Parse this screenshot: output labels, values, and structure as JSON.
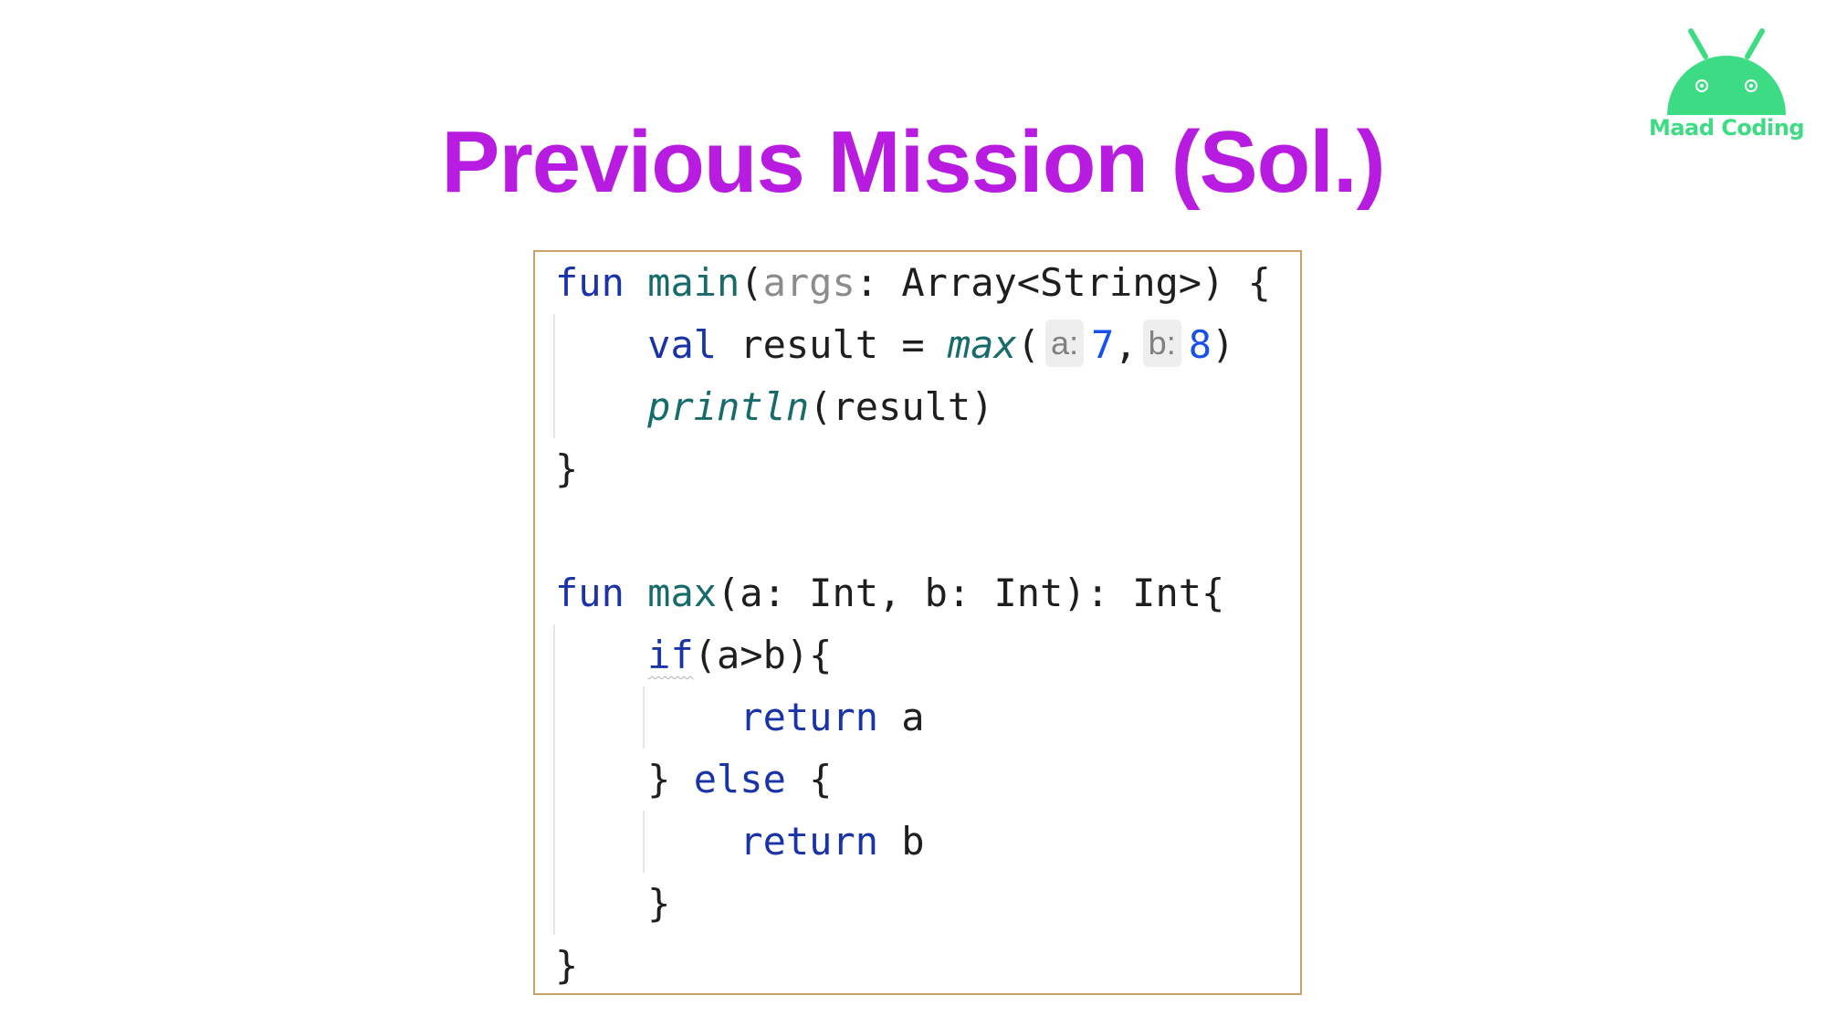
{
  "slide": {
    "title": "Previous Mission (Sol.)"
  },
  "logo": {
    "text": "Maad Coding",
    "icon": "android-robot-icon",
    "color": "#3ddc84"
  },
  "code": {
    "line1": {
      "kw": "fun",
      "name": "main",
      "open": "(",
      "param": "args",
      "rest": ": Array<String>) {"
    },
    "line2": {
      "kw": "val",
      "mid": "result = ",
      "fn": "max",
      "open": "(",
      "hint_a": "a:",
      "arg_a": "7",
      "comma": ",",
      "hint_b": "b:",
      "arg_b": "8",
      "close": ")"
    },
    "line3": {
      "fn": "println",
      "rest": "(result)"
    },
    "line4": "}",
    "line6": {
      "kw": "fun",
      "name": "max",
      "rest": "(a: Int, b: Int): Int{"
    },
    "line7": {
      "kw": "if",
      "rest": "(a>b){"
    },
    "line8": {
      "kw": "return",
      "rest": " a"
    },
    "line9": {
      "brace": "} ",
      "kw": "else",
      "rest": " {"
    },
    "line10": {
      "kw": "return",
      "rest": " b"
    },
    "line11": "}",
    "line12": "}"
  },
  "colors": {
    "title": "#b81ce0",
    "keyword": "#1a34a8",
    "function": "#176b6b",
    "number": "#1750eb",
    "panel_border": "#c9a36b"
  }
}
